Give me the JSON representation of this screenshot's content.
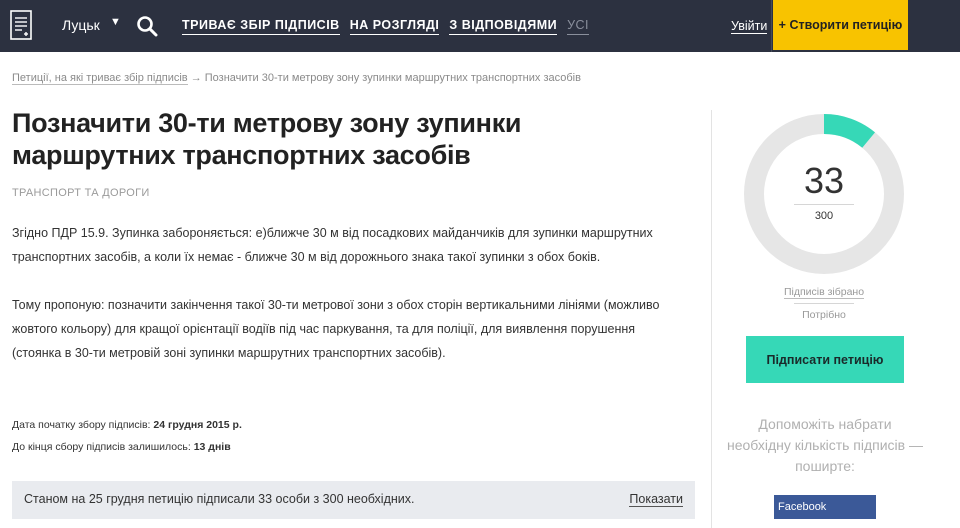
{
  "header": {
    "city": "Луцьк",
    "nav": [
      "ТРИВАЄ ЗБІР ПІДПИСІВ",
      "НА РОЗГЛЯДІ",
      "З ВІДПОВІДЯМИ",
      "УСІ"
    ],
    "login_label": "Увійти",
    "create_label": "+ Створити петицію",
    "icons": {
      "logo": "document-icon",
      "caret": "chevron-down-icon",
      "search": "search-icon"
    },
    "colors": {
      "bar": "#2c3140",
      "accent": "#f8c300"
    }
  },
  "breadcrumb": {
    "link": "Петиції, на які триває збір підписів",
    "arrow": "→",
    "current": "Позначити 30-ти метрову зону зупинки маршрутних транспортних засобів"
  },
  "petition": {
    "title": "Позначити 30-ти метрову зону зупинки маршрутних транспортних засобів",
    "category": "ТРАНСПОРТ ТА ДОРОГИ",
    "paragraphs": [
      "Згідно ПДР 15.9. Зупинка забороняється: е)ближче 30 м від посадкових майданчиків для зупинки маршрутних транспортних засобів, а коли їх немає - ближче 30 м від дорожнього знака такої зупинки з обох боків.",
      "Тому пропоную: позначити закінчення такої 30-ти метрової зони з обох сторін вертикальними лініями (можливо жовтого кольору) для кращої орієнтації водіїв під час паркування, та для поліції, для виявлення порушення (стоянка в 30-ти метровій зоні зупинки маршрутних транспортних засобів)."
    ],
    "start_label": "Дата початку збору підписів:",
    "start_value": "24 грудня 2015 р.",
    "remaining_label": "До кінця сбору підписів залишилось:",
    "remaining_value": "13 днів"
  },
  "status": {
    "text": "Станом на 25 грудня петицію підписали 33 особи з 300 необхідних.",
    "link": "Показати"
  },
  "signatures": {
    "collected": 33,
    "required": 300,
    "collected_label": "Підписів зібрано",
    "required_label": "Потрібно",
    "colors": {
      "progress": "#36d8b7",
      "track": "#e6e6e6"
    }
  },
  "sidebar": {
    "sign_label": "Підписати петицію",
    "share_text": "Допоможіть набрати необхідну кількість підписів — поширте:",
    "facebook_label": "Facebook"
  }
}
